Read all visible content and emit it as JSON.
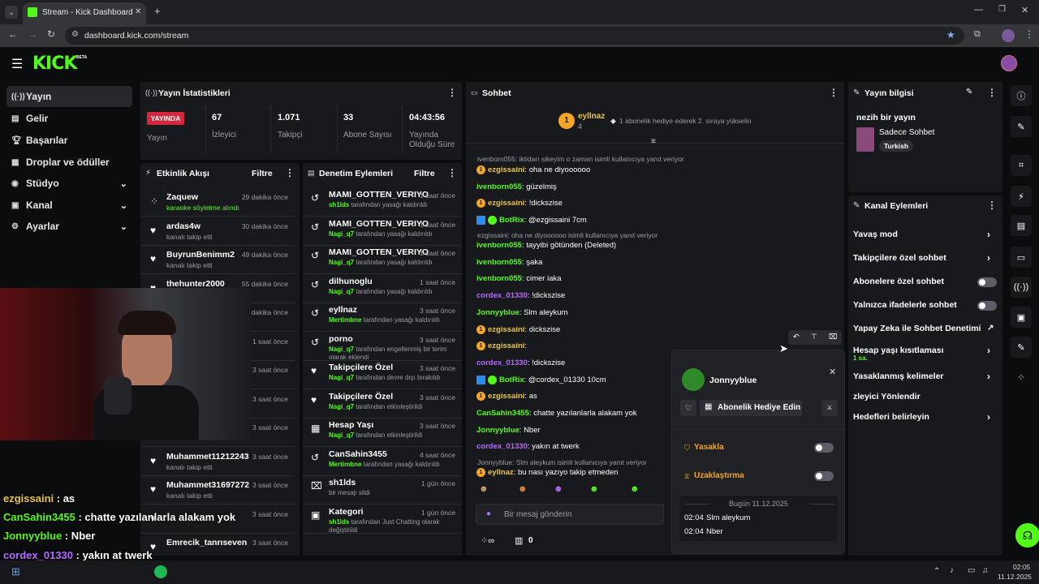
{
  "browser": {
    "tab_title": "Stream - Kick Dashboard",
    "url": "dashboard.kick.com/stream"
  },
  "brand": {
    "logo": "KICK",
    "beta": "BETA"
  },
  "sidebar": {
    "items": [
      {
        "label": "Yayın",
        "icon": "broadcast-icon"
      },
      {
        "label": "Gelir",
        "icon": "money-icon"
      },
      {
        "label": "Başarılar",
        "icon": "trophy-icon"
      },
      {
        "label": "Droplar ve ödüller",
        "icon": "gift-icon"
      },
      {
        "label": "Stüdyo",
        "icon": "studio-icon"
      },
      {
        "label": "Kanal",
        "icon": "channel-icon"
      },
      {
        "label": "Ayarlar",
        "icon": "gear-icon"
      }
    ]
  },
  "stats": {
    "title": "Yayın İstatistikleri",
    "live_badge": "YAYINDA",
    "live_label": "Yayın",
    "viewers": "67",
    "viewers_label": "İzleyici",
    "followers": "1.071",
    "followers_label": "Takipçi",
    "subs": "33",
    "subs_label": "Abone Sayısı",
    "uptime": "04:43:56",
    "uptime_label": "Yayında Olduğu Süre"
  },
  "activity": {
    "title": "Etkinlik Akışı",
    "filter": "Filtre",
    "rows": [
      {
        "name": "Zaquew",
        "time": "29 dakika önce",
        "sub": "karaoke söyletme alındı"
      },
      {
        "name": "ardas4w",
        "time": "30 dakika önce",
        "sub": "kanalı takip etti"
      },
      {
        "name": "BuyrunBenimm2",
        "time": "49 dakika önce",
        "sub": "kanalı takip etti"
      },
      {
        "name": "thehunter2000",
        "time": "55 dakika önce",
        "sub": ""
      },
      {
        "name": "",
        "time": "3 dakika önce",
        "sub": ""
      },
      {
        "name": "",
        "time": "1 saat önce",
        "sub": ""
      },
      {
        "name": "",
        "time": "3 saat önce",
        "sub": ""
      },
      {
        "name": "",
        "time": "3 saat önce",
        "sub": ""
      },
      {
        "name": "",
        "time": "3 saat önce",
        "sub": ""
      },
      {
        "name": "Muhammet11212243",
        "time": "3 saat önce",
        "sub": "kanalı takip etti"
      },
      {
        "name": "Muhammet31697272",
        "time": "3 saat önce",
        "sub": "kanalı takip etti"
      },
      {
        "name": "",
        "time": "3 saat önce",
        "sub": ""
      },
      {
        "name": "Emrecik_tanrıseven",
        "time": "3 saat önce",
        "sub": ""
      }
    ]
  },
  "modlog": {
    "title": "Denetim Eylemleri",
    "filter": "Filtre",
    "rows": [
      {
        "name": "MAMI_GOTTEN_VERIYO",
        "time": "1 saat önce",
        "actor": "sh1lds",
        "sub": " tarafından yasağı kaldırıldı"
      },
      {
        "name": "MAMI_GOTTEN_VERIYO",
        "time": "1 saat önce",
        "actor": "Nagi_q7",
        "sub": " tarafından yasağı kaldırıldı"
      },
      {
        "name": "MAMI_GOTTEN_VERIYO",
        "time": "1 saat önce",
        "actor": "Nagi_q7",
        "sub": " tarafından yasağı kaldırıldı"
      },
      {
        "name": "dilhunoglu",
        "time": "1 saat önce",
        "actor": "Nagi_q7",
        "sub": " tarafından yasağı kaldırıldı"
      },
      {
        "name": "eyllnaz",
        "time": "3 saat önce",
        "actor": "Mertimbne",
        "sub": " tarafından yasağı kaldırıldı"
      },
      {
        "name": "porno",
        "time": "3 saat önce",
        "actor": "Nagi_q7",
        "sub": " tarafından engellenmiş bir terim olarak eklendi"
      },
      {
        "name": "Takipçilere Özel",
        "time": "3 saat önce",
        "actor": "Nagi_q7",
        "sub": " tarafından devre dışı bırakıldı"
      },
      {
        "name": "Takipçilere Özel",
        "time": "3 saat önce",
        "actor": "Nagi_q7",
        "sub": " tarafından etkinleştirildi"
      },
      {
        "name": "Hesap Yaşı",
        "time": "3 saat önce",
        "actor": "Nagi_q7",
        "sub": " tarafından etkinleştirildi"
      },
      {
        "name": "CanSahin3455",
        "time": "4 saat önce",
        "actor": "Mertimbne",
        "sub": " tarafından yasağı kaldırıldı"
      },
      {
        "name": "sh1lds",
        "time": "1 gün önce",
        "actor": "",
        "sub": "bir mesajı sildi"
      },
      {
        "name": "Kategori",
        "time": "1 gün önce",
        "actor": "sh1lds",
        "sub": " tarafından Just Chatting olarak değiştirildi"
      }
    ]
  },
  "chat": {
    "title": "Sohbet",
    "pinned_user": "eyllnaz",
    "pinned_count": "4",
    "pinned_text": "1 abonelik hediye ederek 2. sıraya yükselin",
    "input_placeholder": "Bir mesaj gönderin",
    "kicks": "0",
    "messages": [
      {
        "reply": "ivenborn055: iktidarı sikeyim o zaman isimli kullanıcıya yanıt veriyor"
      },
      {
        "user": "ezgissaini",
        "text": ": oha ne diyoooooo",
        "color": "#e8c547"
      },
      {
        "user": "ivenborn055",
        "text": ": güzelmiş",
        "color": "#53fc18"
      },
      {
        "user": "ezgissaini",
        "text": ": !dickszise",
        "color": "#e8c547"
      },
      {
        "user": "BotRix",
        "text": ": @ezgissaini 7cm",
        "color": "#53fc18"
      },
      {
        "reply": "ezgissaini: oha ne diyoooooo isimli kullanıcıya yanıt veriyor"
      },
      {
        "user": "ivenborn055",
        "text": ": tayyibi götünden (Deleted)",
        "color": "#53fc18"
      },
      {
        "user": "ivenborn055",
        "text": ": şaka",
        "color": "#53fc18"
      },
      {
        "user": "ivenborn055",
        "text": ": cimer iaka",
        "color": "#53fc18"
      },
      {
        "user": "cordex_01330",
        "text": ": !dickszise",
        "color": "#b56bff"
      },
      {
        "user": "Jonnyyblue",
        "text": ": Slm aleykum",
        "color": "#53fc18"
      },
      {
        "user": "ezgissaini",
        "text": ": dickszise",
        "color": "#e8c547"
      },
      {
        "user": "ezgissaini",
        "text": ":",
        "color": "#e8c547"
      },
      {
        "user": "cordex_01330",
        "text": ": !dickszise",
        "color": "#b56bff"
      },
      {
        "user": "BotRix",
        "text": ": @cordex_01330 10cm",
        "color": "#53fc18"
      },
      {
        "user": "ezgissaini",
        "text": ": as",
        "color": "#e8c547"
      },
      {
        "user": "CanSahin3455",
        "text": ": chatte yazılanlarla alakam yok",
        "color": "#53fc18"
      },
      {
        "user": "Jonnyyblue",
        "text": ": Nber",
        "color": "#53fc18"
      },
      {
        "user": "cordex_01330",
        "text": ": yakın at twerk",
        "color": "#b56bff"
      },
      {
        "reply": "Jonnyyblue: Slm aleykum isimli kullanıcıya yanıt veriyor"
      },
      {
        "user": "eyllnaz",
        "text": ": bu nası yazıyo takip etmeden",
        "color": "#e8c547"
      }
    ]
  },
  "usercard": {
    "name": "Jonnyyblue",
    "gift_button": "Abonelik Hediye Edin",
    "ban_label": "Yasakla",
    "timeout_label": "Uzaklaştırma",
    "date_label": "Bugün 11.12.2025",
    "messages": [
      {
        "time": "02:04",
        "text": "Slm aleykum"
      },
      {
        "time": "02:04",
        "text": "Nber"
      }
    ]
  },
  "streaminfo": {
    "title": "Yayın bilgisi",
    "stream_title": "nezih bir yayın",
    "category": "Sadece Sohbet",
    "tag": "Turkish"
  },
  "channel_actions": {
    "title": "Kanal Eylemleri",
    "items": [
      {
        "label": "Yavaş mod",
        "kind": "arrow"
      },
      {
        "label": "Takipçilere özel sohbet",
        "kind": "arrow"
      },
      {
        "label": "Abonelere özel sohbet",
        "kind": "toggle"
      },
      {
        "label": "Yalnızca ifadelerle sohbet",
        "kind": "toggle"
      },
      {
        "label": "Yapay Zeka ile Sohbet Denetimi",
        "kind": "external"
      },
      {
        "label": "Hesap yaşı kısıtlaması",
        "kind": "arrow",
        "sub": "1 sa."
      },
      {
        "label": "Yasaklanmış kelimeler",
        "kind": "arrow"
      },
      {
        "label": "zleyici Yönlendir",
        "kind": "none"
      },
      {
        "label": "Hedefleri belirleyin",
        "kind": "arrow"
      }
    ]
  },
  "overlay_chat": [
    {
      "user": "ezgissaini",
      "text": " : as",
      "color": "#e8c547"
    },
    {
      "user": "CanSahin3455",
      "text": " : chatte yazılanlarla alakam yok",
      "color": "#53fc18"
    },
    {
      "user": "Jonnyyblue",
      "text": " : Nber",
      "color": "#53fc18"
    },
    {
      "user": "cordex_01330",
      "text": " : yakın at twerk",
      "color": "#b56bff"
    },
    {
      "user": "",
      "text": "bu nası yazıyo takip etmeden",
      "color": "#fff"
    }
  ],
  "taskbar": {
    "time": "02:05",
    "date": "11.12.2025"
  }
}
